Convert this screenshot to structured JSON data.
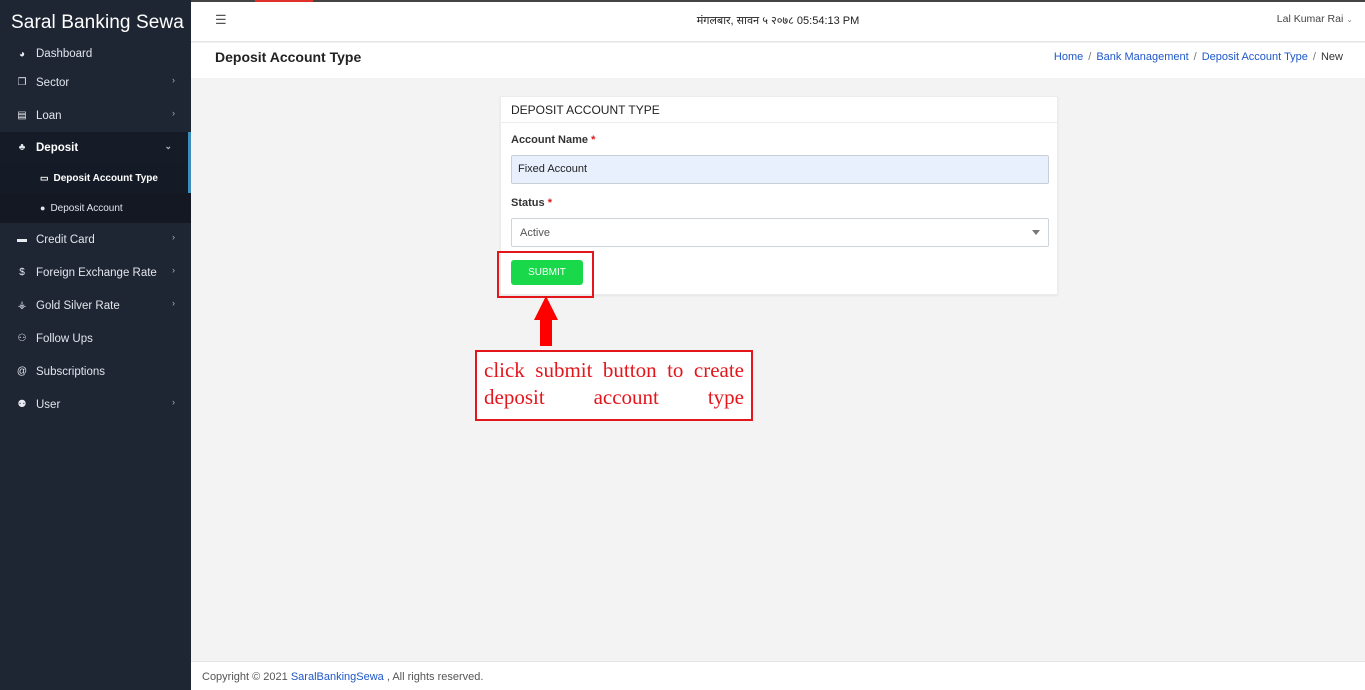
{
  "sidebar": {
    "brand": "Saral Banking Sewa",
    "items": [
      {
        "label": "Dashboard",
        "icon": "dashboard-icon"
      },
      {
        "label": "Sector",
        "icon": "copy-icon"
      },
      {
        "label": "Loan",
        "icon": "card-icon"
      },
      {
        "label": "Deposit",
        "icon": "piggy-bank-icon"
      },
      {
        "label": "Credit Card",
        "icon": "credit-card-icon"
      },
      {
        "label": "Foreign Exchange Rate",
        "icon": "dollar-icon"
      },
      {
        "label": "Gold Silver Rate",
        "icon": "hand-coin-icon"
      },
      {
        "label": "Follow Ups",
        "icon": "user-plus-icon"
      },
      {
        "label": "Subscriptions",
        "icon": "at-icon"
      },
      {
        "label": "User",
        "icon": "users-icon"
      }
    ],
    "deposit_sub": [
      {
        "label": "Deposit Account Type",
        "icon": "id-card-icon"
      },
      {
        "label": "Deposit Account",
        "icon": "user-circle-icon"
      }
    ]
  },
  "topbar": {
    "datetime": "मंगलबार, सावन ५ २०७८ 05:54:13 PM",
    "user_name": "Lal Kumar Rai"
  },
  "page": {
    "title": "Deposit Account Type",
    "breadcrumb": [
      "Home",
      "Bank Management",
      "Deposit Account Type",
      "New"
    ]
  },
  "form": {
    "card_title": "DEPOSIT ACCOUNT TYPE",
    "account_name_label": "Account Name",
    "account_name_value": "Fixed Account",
    "status_label": "Status",
    "status_value": "Active",
    "required_mark": "*",
    "submit_label": "SUBMIT"
  },
  "annotation": {
    "text": "click submit button to create deposit account type",
    "color": "#e4161c"
  },
  "footer": {
    "prefix": "Copyright © 2021",
    "link": "SaralBankingSewa",
    "suffix": ", All rights reserved."
  },
  "colors": {
    "sidebar_bg": "#1e2533",
    "submit_button": "#19d84a",
    "link": "#1f58c7",
    "required": "#e01818"
  }
}
